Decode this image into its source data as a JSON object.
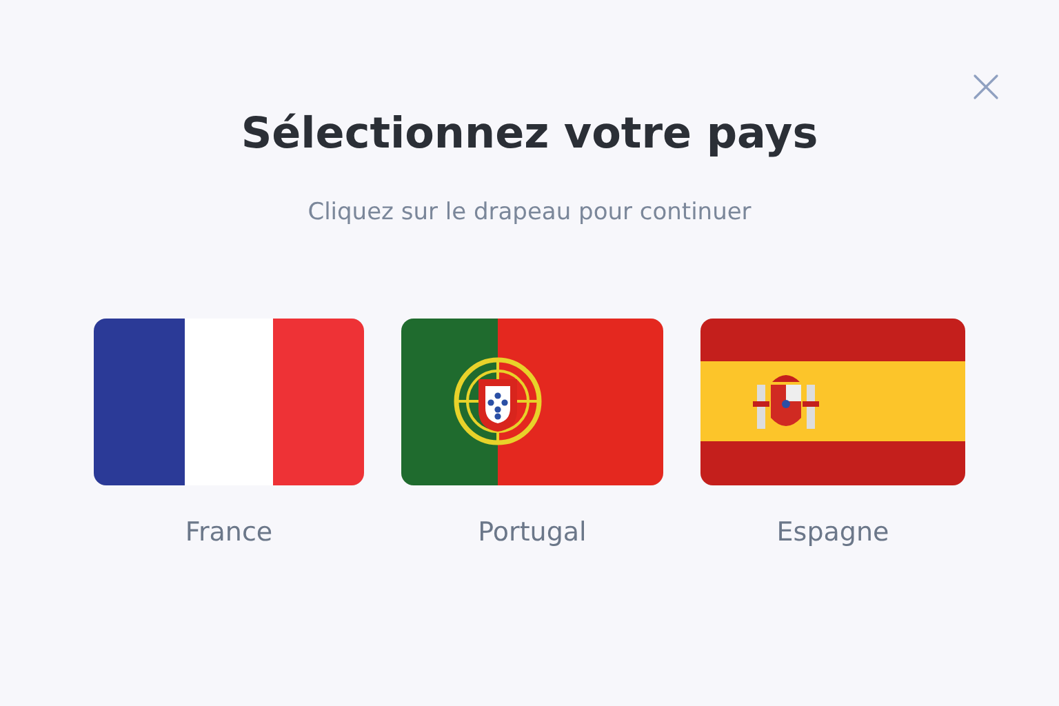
{
  "title": "Sélectionnez votre pays",
  "subtitle": "Cliquez sur le drapeau pour continuer",
  "countries": [
    {
      "kind": "france",
      "name": "France"
    },
    {
      "kind": "portugal",
      "name": "Portugal"
    },
    {
      "kind": "spain",
      "name": "Espagne"
    }
  ]
}
